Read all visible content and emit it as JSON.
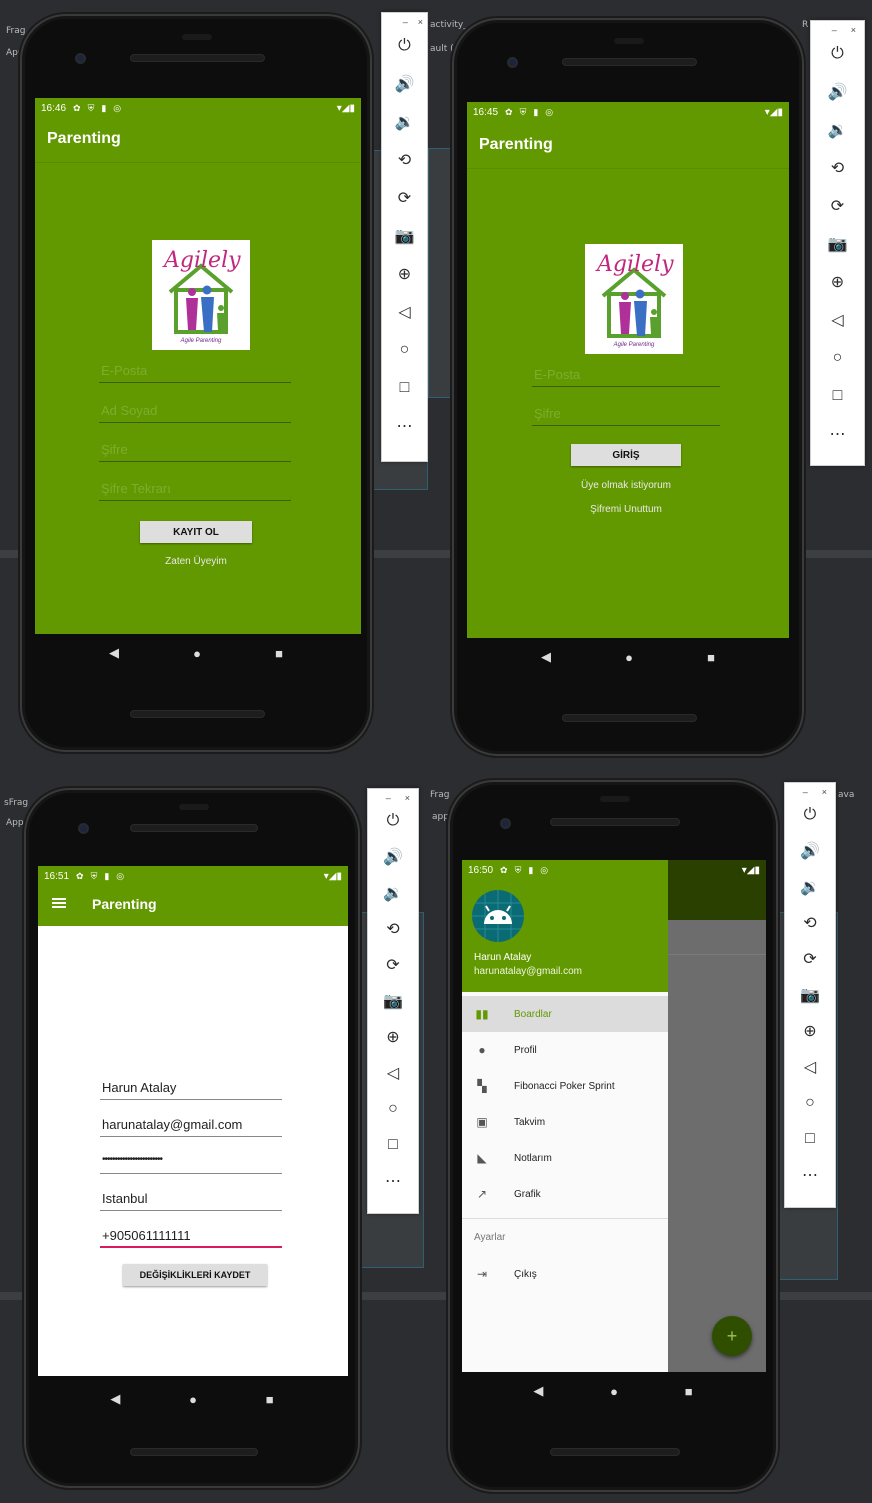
{
  "colors": {
    "app_green": "#639900",
    "dark_green": "#2f4e00",
    "selected_green": "#639900"
  },
  "status": {
    "time_register": "16:46",
    "time_login": "16:45",
    "time_profile": "16:51",
    "time_drawer": "16:50",
    "left_icons": [
      "✿",
      "⛨",
      "▮",
      "◎"
    ],
    "right_icons": "▾◢▮"
  },
  "ide": {
    "frag_tl": "Frag",
    "app_tl": "App",
    "activity_tab": "activity_",
    "default_tab": "ault (e",
    "frag_bl": "sFrag",
    "app_bl": "App",
    "frag_br": "Frag",
    "app_br": "app",
    "java_br": "ava",
    "r_tr": "R",
    "java_br2": "ava"
  },
  "register": {
    "title": "Parenting",
    "logo_text": "Agilely",
    "logo_sub": "Agile Parenting",
    "email_hint": "E-Posta",
    "name_hint": "Ad Soyad",
    "password_hint": "Şifre",
    "password_repeat_hint": "Şifre Tekrarı",
    "register_button": "KAYIT OL",
    "already_member": "Zaten Üyeyim"
  },
  "login": {
    "title": "Parenting",
    "logo_text": "Agilely",
    "logo_sub": "Agile Parenting",
    "email_hint": "E-Posta",
    "password_hint": "Şifre",
    "login_button": "GİRİŞ",
    "want_member": "Üye olmak istiyorum",
    "forgot_password": "Şifremi Unuttum"
  },
  "profile": {
    "title": "Parenting",
    "name_value": "Harun Atalay",
    "email_value": "harunatalay@gmail.com",
    "password_value": "••••••••••••••••••••••••",
    "city_value": "Istanbul",
    "phone_value": "+905061111111",
    "save_button": "DEĞİŞİKLİKLERİ KAYDET"
  },
  "drawer": {
    "user_name": "Harun Atalay",
    "user_email": "harunatalay@gmail.com",
    "items": [
      {
        "icon": "▮▮",
        "label": "Boardlar",
        "selected": true
      },
      {
        "icon": "●",
        "label": "Profil",
        "selected": false
      },
      {
        "icon": "▚",
        "label": "Fibonacci Poker Sprint",
        "selected": false
      },
      {
        "icon": "▣",
        "label": "Takvim",
        "selected": false
      },
      {
        "icon": "◣",
        "label": "Notlarım",
        "selected": false
      },
      {
        "icon": "↗",
        "label": "Grafik",
        "selected": false
      }
    ],
    "section_settings": "Ayarlar",
    "logout_icon": "⇥",
    "logout": "Çıkış",
    "fab_label": "+"
  },
  "emulator_toolbar": {
    "window_controls": [
      "–",
      "×"
    ],
    "icons": [
      "power-icon",
      "volume-up-icon",
      "volume-down-icon",
      "rotate-left-icon",
      "rotate-right-icon",
      "camera-icon",
      "zoom-icon",
      "back-icon",
      "home-icon",
      "overview-icon",
      "more-icon"
    ],
    "glyphs": [
      "⏻",
      "🔊",
      "🔉",
      "⟲",
      "⟳",
      "📷",
      "⊕",
      "◁",
      "○",
      "□",
      "⋯"
    ]
  },
  "nav": {
    "back": "◀",
    "home": "●",
    "recents": "■"
  }
}
